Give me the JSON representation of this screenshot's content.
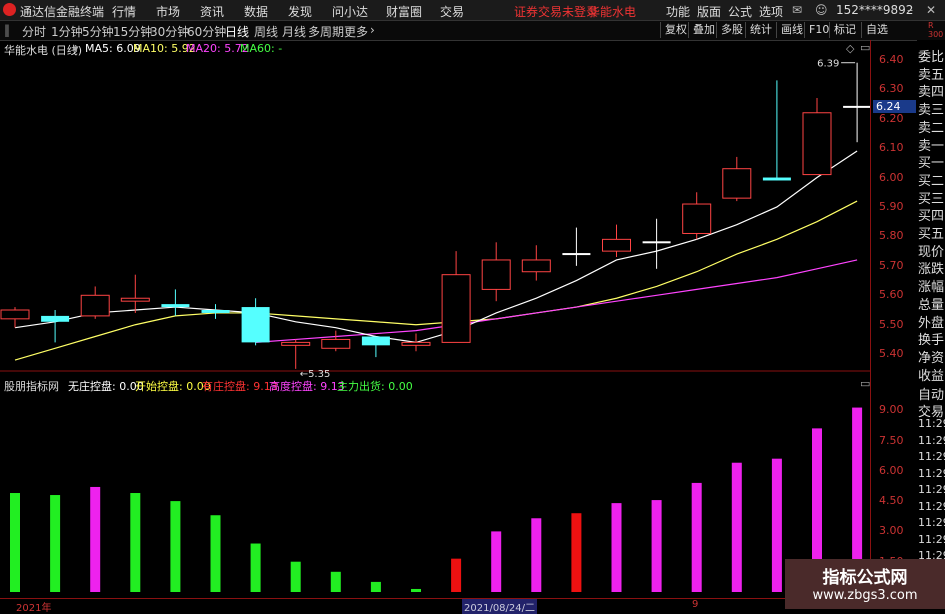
{
  "app": {
    "title": "通达信金融终端"
  },
  "menu": [
    "行情",
    "市场",
    "资讯",
    "数据",
    "发现",
    "问小达",
    "财富圈",
    "交易"
  ],
  "warning": "证券交易未登录",
  "stock_name_top": "华能水电",
  "right_menu": [
    "功能",
    "版面",
    "公式",
    "选项"
  ],
  "account": "152****9892",
  "periods": [
    "分时",
    "1分钟",
    "5分钟",
    "15分钟",
    "30分钟",
    "60分钟",
    "日线",
    "周线",
    "月线",
    "多周期",
    "更多"
  ],
  "active_period": "日线",
  "toolbar": [
    "复权",
    "叠加",
    "多股",
    "统计",
    "画线",
    "F10",
    "标记",
    "自选"
  ],
  "main_chart": {
    "title": "华能水电 (日线)",
    "ma_labels": [
      {
        "label": "MA5: 6.09",
        "color": "#ffffff"
      },
      {
        "label": "MA10: 5.92",
        "color": "#ffff66"
      },
      {
        "label": "MA20: 5.72",
        "color": "#ff44ff"
      },
      {
        "label": "MA60: -",
        "color": "#44ff44"
      }
    ],
    "current_price": "6.24",
    "high_label": "6.39",
    "low_label": "5.35"
  },
  "sub_chart": {
    "title": "股朋指标网",
    "labels": [
      {
        "label": "无庄控盘: 0.00",
        "color": "#ffffff"
      },
      {
        "label": "开始控盘: 0.00",
        "color": "#ffff44"
      },
      {
        "label": "有庄控盘: 9.13",
        "color": "#ff3333"
      },
      {
        "label": "高度控盘: 9.13",
        "color": "#ff44ff"
      },
      {
        "label": "主力出货: 0.00",
        "color": "#44ff44"
      }
    ]
  },
  "side_panel": [
    "委比",
    "卖五",
    "卖四",
    "卖三",
    "卖二",
    "卖一",
    "买一",
    "买二",
    "买三",
    "买四",
    "买五",
    "现价",
    "涨跌",
    "涨幅",
    "总量",
    "外盘",
    "换手",
    "净资",
    "收益",
    "自动",
    "交易",
    "11:29",
    "11:29",
    "11:29",
    "11:29",
    "11:29",
    "11:29",
    "11:29",
    "11:29",
    "11:29"
  ],
  "bottom_axis": {
    "left": "2021年",
    "mid": "2021/08/24/二",
    "right": "9"
  },
  "watermark": {
    "line1": "指标公式网",
    "line2": "www.zbgs3.com"
  },
  "chart_data": [
    {
      "type": "candlestick",
      "y_ticks": [
        "6.40",
        "6.30",
        "6.20",
        "6.10",
        "6.00",
        "5.90",
        "5.80",
        "5.70",
        "5.60",
        "5.50",
        "5.40"
      ],
      "ylim": [
        5.37,
        6.44
      ],
      "candles": [
        {
          "o": 5.52,
          "c": 5.55,
          "h": 5.56,
          "l": 5.49
        },
        {
          "o": 5.53,
          "c": 5.51,
          "h": 5.55,
          "l": 5.44
        },
        {
          "o": 5.53,
          "c": 5.6,
          "h": 5.63,
          "l": 5.52
        },
        {
          "o": 5.58,
          "c": 5.59,
          "h": 5.67,
          "l": 5.54
        },
        {
          "o": 5.57,
          "c": 5.56,
          "h": 5.62,
          "l": 5.53
        },
        {
          "o": 5.55,
          "c": 5.54,
          "h": 5.57,
          "l": 5.52
        },
        {
          "o": 5.56,
          "c": 5.44,
          "h": 5.59,
          "l": 5.43
        },
        {
          "o": 5.43,
          "c": 5.44,
          "h": 5.45,
          "l": 5.35
        },
        {
          "o": 5.42,
          "c": 5.45,
          "h": 5.48,
          "l": 5.41
        },
        {
          "o": 5.46,
          "c": 5.43,
          "h": 5.46,
          "l": 5.39
        },
        {
          "o": 5.43,
          "c": 5.44,
          "h": 5.47,
          "l": 5.41
        },
        {
          "o": 5.44,
          "c": 5.67,
          "h": 5.75,
          "l": 5.44
        },
        {
          "o": 5.62,
          "c": 5.72,
          "h": 5.78,
          "l": 5.58
        },
        {
          "o": 5.68,
          "c": 5.72,
          "h": 5.77,
          "l": 5.65
        },
        {
          "o": 5.74,
          "c": 5.74,
          "h": 5.83,
          "l": 5.7
        },
        {
          "o": 5.75,
          "c": 5.79,
          "h": 5.84,
          "l": 5.73
        },
        {
          "o": 5.78,
          "c": 5.78,
          "h": 5.86,
          "l": 5.69
        },
        {
          "o": 5.81,
          "c": 5.91,
          "h": 5.95,
          "l": 5.79
        },
        {
          "o": 5.93,
          "c": 6.03,
          "h": 6.07,
          "l": 5.92
        },
        {
          "o": 6.0,
          "c": 5.99,
          "h": 6.33,
          "l": 5.99
        },
        {
          "o": 6.01,
          "c": 6.22,
          "h": 6.27,
          "l": 6.01
        },
        {
          "o": 6.24,
          "c": 6.24,
          "h": 6.39,
          "l": 6.12
        }
      ],
      "ma5": [
        5.49,
        5.51,
        5.54,
        5.55,
        5.56,
        5.55,
        5.54,
        5.51,
        5.49,
        5.46,
        5.44,
        5.48,
        5.54,
        5.59,
        5.65,
        5.72,
        5.75,
        5.79,
        5.84,
        5.9,
        6.0,
        6.09
      ],
      "ma10": [
        5.38,
        5.42,
        5.46,
        5.5,
        5.53,
        5.54,
        5.54,
        5.53,
        5.52,
        5.51,
        5.5,
        5.51,
        5.52,
        5.54,
        5.56,
        5.59,
        5.63,
        5.68,
        5.74,
        5.79,
        5.85,
        5.92
      ],
      "ma20": [
        null,
        null,
        null,
        null,
        null,
        null,
        5.44,
        5.45,
        5.46,
        5.47,
        5.48,
        5.5,
        5.52,
        5.54,
        5.56,
        5.58,
        5.6,
        5.62,
        5.64,
        5.66,
        5.69,
        5.72
      ]
    },
    {
      "type": "bar",
      "y_ticks": [
        "9.00",
        "7.50",
        "6.00",
        "4.50",
        "3.00",
        "1.50"
      ],
      "ylim": [
        0,
        10
      ],
      "values": [
        4.9,
        4.8,
        5.2,
        4.9,
        4.5,
        3.8,
        2.4,
        1.5,
        1.0,
        0.5,
        0.15,
        1.65,
        3.0,
        3.65,
        3.9,
        4.4,
        4.55,
        5.4,
        6.4,
        6.6,
        8.1,
        9.13
      ],
      "colors": [
        "#22ee22",
        "#22ee22",
        "#ee22ee",
        "#22ee22",
        "#22ee22",
        "#22ee22",
        "#22ee22",
        "#22ee22",
        "#22ee22",
        "#22ee22",
        "#22ee22",
        "#ee1111",
        "#ee22ee",
        "#ee22ee",
        "#ee1111",
        "#ee22ee",
        "#ee22ee",
        "#ee22ee",
        "#ee22ee",
        "#ee22ee",
        "#ee22ee",
        "#ee22ee"
      ]
    }
  ]
}
